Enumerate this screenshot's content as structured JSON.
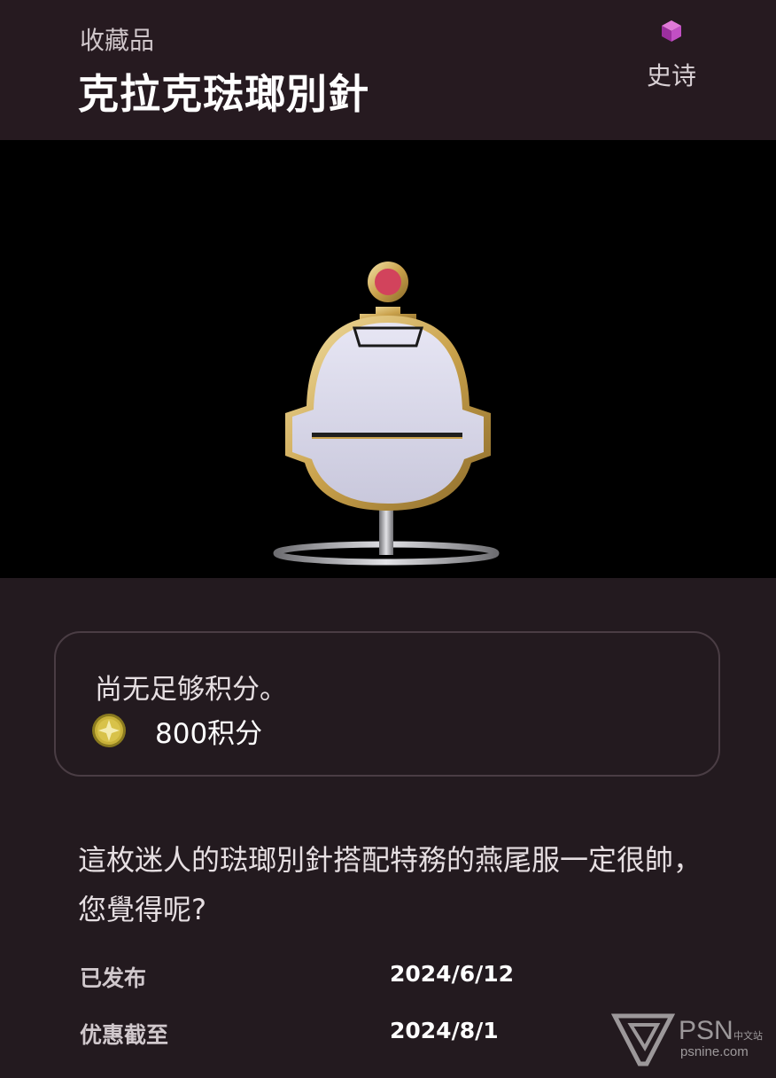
{
  "header": {
    "category": "收藏品",
    "title": "克拉克琺瑯別針",
    "rarity": "史诗"
  },
  "points": {
    "status": "尚无足够积分。",
    "value": "800积分"
  },
  "description": "這枚迷人的琺瑯別針搭配特務的燕尾服一定很帥，您覺得呢?",
  "meta": {
    "released_label": "已发布",
    "released_value": "2024/6/12",
    "offer_label": "优惠截至",
    "offer_value": "2024/8/1"
  },
  "watermark": {
    "brand": "PSN",
    "sub": "中文站",
    "site": "psnine.com"
  },
  "icons": {
    "rarity": "rarity-cube-icon",
    "coin": "points-coin-icon",
    "logo": "psnine-logo-icon"
  },
  "colors": {
    "background": "#231a1f",
    "rarity_accent": "#b13ab8",
    "coin": "#c9b23a"
  }
}
